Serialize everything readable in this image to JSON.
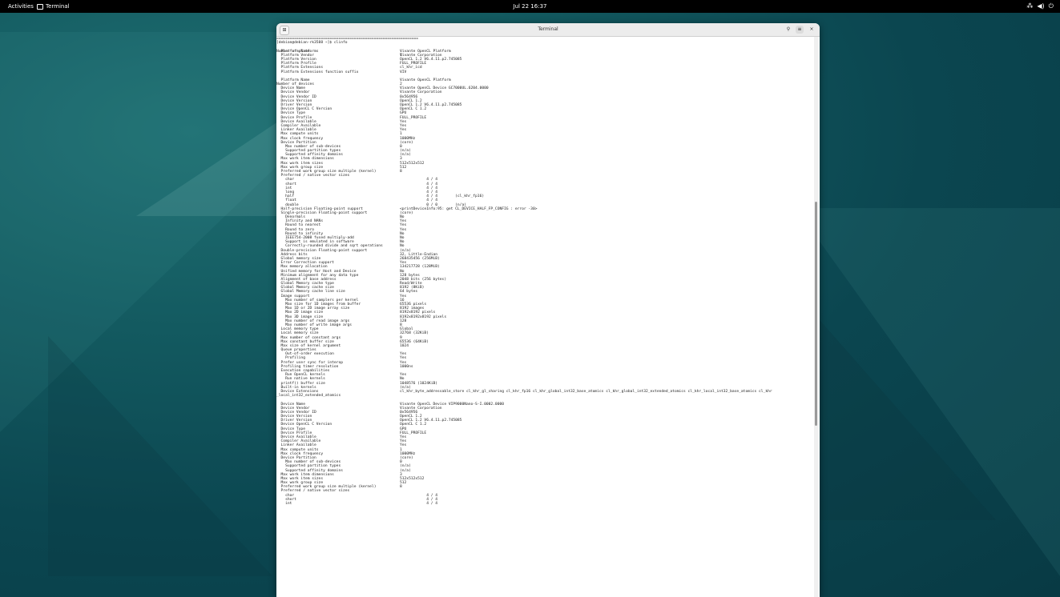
{
  "topbar": {
    "activities": "Activities",
    "app_name": "Terminal",
    "clock": "Jul 22 16:37",
    "tray_icons": [
      "network-icon",
      "volume-icon",
      "power-icon"
    ]
  },
  "window": {
    "title": "Terminal",
    "separator": "================================================================",
    "prompt": "[debian@debian-rk3588 ~]$ clinfo",
    "platform_header_label": "Number of platforms",
    "platform_header_value": "1"
  },
  "platform_lines": [
    {
      "k": "  Platform Name",
      "v": "Vivante OpenCL Platform"
    },
    {
      "k": "  Platform Vendor",
      "v": "Vivante Corporation"
    },
    {
      "k": "  Platform Version",
      "v": "OpenCL 1.2 V6.4.11.p2.745085"
    },
    {
      "k": "  Platform Profile",
      "v": "FULL_PROFILE"
    },
    {
      "k": "  Platform Extensions",
      "v": "cl_khr_icd"
    },
    {
      "k": "  Platform Extensions function suffix",
      "v": "VIV"
    },
    {
      "k": "",
      "v": ""
    },
    {
      "k": "  Platform Name",
      "v": "Vivante OpenCL Platform"
    },
    {
      "k": "Number of devices",
      "v": "2"
    }
  ],
  "device1_lines": [
    {
      "k": "  Device Name",
      "v": "Vivante OpenCL Device GC7000UL.6204.0000"
    },
    {
      "k": "  Device Vendor",
      "v": "Vivante Corporation"
    },
    {
      "k": "  Device Vendor ID",
      "v": "0x564956"
    },
    {
      "k": "  Device Version",
      "v": "OpenCL 1.2"
    },
    {
      "k": "  Driver Version",
      "v": "OpenCL 1.2 V6.4.11.p2.745085"
    },
    {
      "k": "  Device OpenCL C Version",
      "v": "OpenCL C 1.2"
    },
    {
      "k": "  Device Type",
      "v": "GPU"
    },
    {
      "k": "  Device Profile",
      "v": "FULL_PROFILE"
    },
    {
      "k": "  Device Available",
      "v": "Yes"
    },
    {
      "k": "  Compiler Available",
      "v": "Yes"
    },
    {
      "k": "  Linker Available",
      "v": "Yes"
    },
    {
      "k": "  Max compute units",
      "v": "1"
    },
    {
      "k": "  Max clock frequency",
      "v": "1000MHz"
    },
    {
      "k": "  Device Partition",
      "v": "(core)"
    },
    {
      "k": "    Max number of sub-devices",
      "v": "0"
    },
    {
      "k": "    Supported partition types",
      "v": "(n/a)"
    },
    {
      "k": "    Supported affinity domains",
      "v": "(n/a)"
    },
    {
      "k": "  Max work item dimensions",
      "v": "3"
    },
    {
      "k": "  Max work item sizes",
      "v": "512x512x512"
    },
    {
      "k": "  Max work group size",
      "v": "512"
    },
    {
      "k": "  Preferred work group size multiple (kernel)",
      "v": "8"
    },
    {
      "k": "  Preferred / native vector sizes",
      "v": ""
    },
    {
      "k": "    char",
      "v": "            4 / 4"
    },
    {
      "k": "    short",
      "v": "            4 / 4"
    },
    {
      "k": "    int",
      "v": "            4 / 4"
    },
    {
      "k": "    long",
      "v": "            4 / 4"
    },
    {
      "k": "    half",
      "v": "            4 / 4        (cl_khr_fp16)"
    },
    {
      "k": "    float",
      "v": "            4 / 4"
    },
    {
      "k": "    double",
      "v": "            0 / 0        (n/a)"
    },
    {
      "k": "  Half-precision Floating-point support",
      "v": "<printDeviceInfo:95: get CL_DEVICE_HALF_FP_CONFIG : error -30>"
    },
    {
      "k": "  Single-precision Floating-point support",
      "v": "(core)"
    },
    {
      "k": "    Denormals",
      "v": "No"
    },
    {
      "k": "    Infinity and NANs",
      "v": "Yes"
    },
    {
      "k": "    Round to nearest",
      "v": "Yes"
    },
    {
      "k": "    Round to zero",
      "v": "Yes"
    },
    {
      "k": "    Round to infinity",
      "v": "No"
    },
    {
      "k": "    IEEE754-2008 fused multiply-add",
      "v": "No"
    },
    {
      "k": "    Support is emulated in software",
      "v": "No"
    },
    {
      "k": "    Correctly-rounded divide and sqrt operations",
      "v": "No"
    },
    {
      "k": "  Double-precision Floating-point support",
      "v": "(n/a)"
    },
    {
      "k": "  Address bits",
      "v": "32, Little-Endian"
    },
    {
      "k": "  Global memory size",
      "v": "268435456 (256MiB)"
    },
    {
      "k": "  Error Correction support",
      "v": "Yes"
    },
    {
      "k": "  Max memory allocation",
      "v": "134217728 (128MiB)"
    },
    {
      "k": "  Unified memory for Host and Device",
      "v": "No"
    },
    {
      "k": "  Minimum alignment for any data type",
      "v": "128 bytes"
    },
    {
      "k": "  Alignment of base address",
      "v": "2048 bits (256 bytes)"
    },
    {
      "k": "  Global Memory cache type",
      "v": "Read/Write"
    },
    {
      "k": "  Global Memory cache size",
      "v": "8192 (8KiB)"
    },
    {
      "k": "  Global Memory cache line size",
      "v": "64 bytes"
    },
    {
      "k": "  Image support",
      "v": "Yes"
    },
    {
      "k": "    Max number of samplers per kernel",
      "v": "16"
    },
    {
      "k": "    Max size for 1D images from buffer",
      "v": "65536 pixels"
    },
    {
      "k": "    Max 1D or 2D image array size",
      "v": "8192 images"
    },
    {
      "k": "    Max 2D image size",
      "v": "8192x8192 pixels"
    },
    {
      "k": "    Max 3D image size",
      "v": "8192x8192x8192 pixels"
    },
    {
      "k": "    Max number of read image args",
      "v": "128"
    },
    {
      "k": "    Max number of write image args",
      "v": "8"
    },
    {
      "k": "  Local memory type",
      "v": "Global"
    },
    {
      "k": "  Local memory size",
      "v": "32768 (32KiB)"
    },
    {
      "k": "  Max number of constant args",
      "v": "9"
    },
    {
      "k": "  Max constant buffer size",
      "v": "65536 (64KiB)"
    },
    {
      "k": "  Max size of kernel argument",
      "v": "1024"
    },
    {
      "k": "  Queue properties",
      "v": ""
    },
    {
      "k": "    Out-of-order execution",
      "v": "Yes"
    },
    {
      "k": "    Profiling",
      "v": "Yes"
    },
    {
      "k": "  Prefer user sync for interop",
      "v": "Yes"
    },
    {
      "k": "  Profiling timer resolution",
      "v": "1000ns"
    },
    {
      "k": "  Execution capabilities",
      "v": ""
    },
    {
      "k": "    Run OpenCL kernels",
      "v": "Yes"
    },
    {
      "k": "    Run native kernels",
      "v": "No"
    },
    {
      "k": "  printf() buffer size",
      "v": "1048576 (1024KiB)"
    },
    {
      "k": "  Built-in kernels",
      "v": "(n/a)"
    },
    {
      "k": "  Device Extensions",
      "v": "cl_khr_byte_addressable_store cl_khr_gl_sharing cl_khr_fp16 cl_khr_global_int32_base_atomics cl_khr_global_int32_extended_atomics cl_khr_local_int32_base_atomics cl_khr"
    }
  ],
  "wrap_line": "_local_int32_extended_atomics",
  "device2_lines": [
    {
      "k": "  Device Name",
      "v": "Vivante OpenCL Device VIP9000Nano-S-I.0002.0000"
    },
    {
      "k": "  Device Vendor",
      "v": "Vivante Corporation"
    },
    {
      "k": "  Device Vendor ID",
      "v": "0x564956"
    },
    {
      "k": "  Device Version",
      "v": "OpenCL 1.2"
    },
    {
      "k": "  Driver Version",
      "v": "OpenCL 1.2 V6.4.11.p2.745085"
    },
    {
      "k": "  Device OpenCL C Version",
      "v": "OpenCL C 1.2"
    },
    {
      "k": "  Device Type",
      "v": "GPU"
    },
    {
      "k": "  Device Profile",
      "v": "FULL_PROFILE"
    },
    {
      "k": "  Device Available",
      "v": "Yes"
    },
    {
      "k": "  Compiler Available",
      "v": "Yes"
    },
    {
      "k": "  Linker Available",
      "v": "Yes"
    },
    {
      "k": "  Max compute units",
      "v": "1"
    },
    {
      "k": "  Max clock frequency",
      "v": "1000MHz"
    },
    {
      "k": "  Device Partition",
      "v": "(core)"
    },
    {
      "k": "    Max number of sub-devices",
      "v": "0"
    },
    {
      "k": "    Supported partition types",
      "v": "(n/a)"
    },
    {
      "k": "    Supported affinity domains",
      "v": "(n/a)"
    },
    {
      "k": "  Max work item dimensions",
      "v": "3"
    },
    {
      "k": "  Max work item sizes",
      "v": "512x512x512"
    },
    {
      "k": "  Max work group size",
      "v": "512"
    },
    {
      "k": "  Preferred work group size multiple (kernel)",
      "v": "8"
    },
    {
      "k": "  Preferred / native vector sizes",
      "v": ""
    },
    {
      "k": "    char",
      "v": "            4 / 4"
    },
    {
      "k": "    short",
      "v": "            4 / 4"
    },
    {
      "k": "    int",
      "v": "            4 / 4"
    }
  ],
  "scroll": {
    "position_fraction": 0.42
  }
}
